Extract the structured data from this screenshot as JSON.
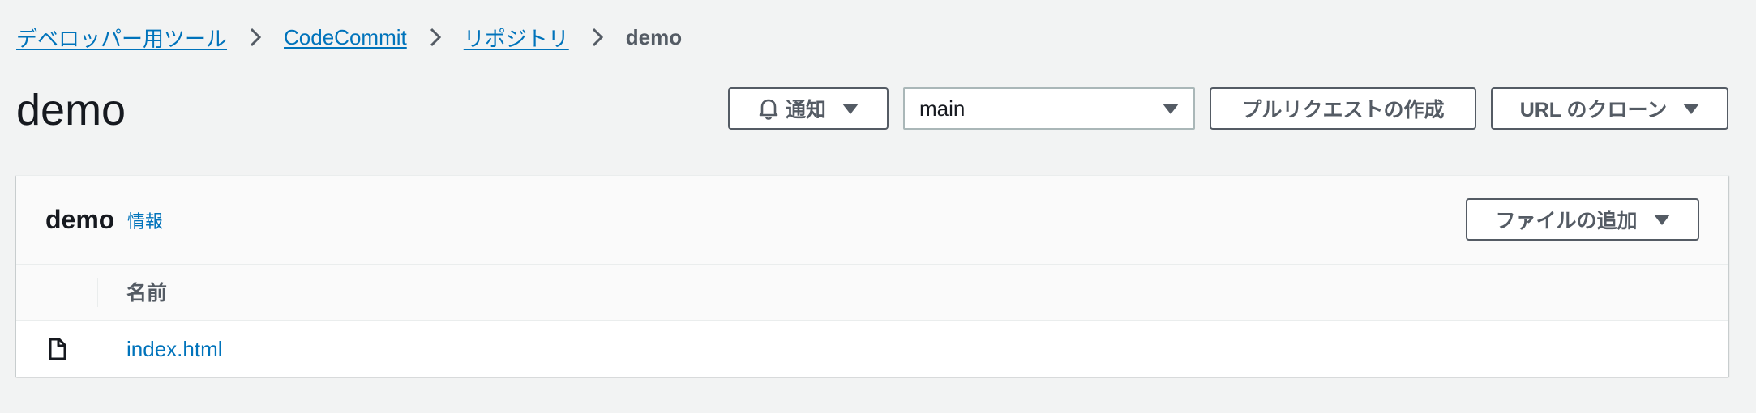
{
  "breadcrumb": {
    "items": [
      {
        "label": "デベロッパー用ツール"
      },
      {
        "label": "CodeCommit"
      },
      {
        "label": "リポジトリ"
      },
      {
        "label": "demo"
      }
    ]
  },
  "header": {
    "title": "demo",
    "notify_label": "通知",
    "branch_value": "main",
    "pull_request_label": "プルリクエストの作成",
    "clone_url_label": "URL のクローン"
  },
  "panel": {
    "title": "demo",
    "info_label": "情報",
    "add_file_label": "ファイルの追加",
    "table": {
      "columns": [
        "名前"
      ],
      "rows": [
        {
          "type": "file-icon",
          "name": "index.html"
        }
      ]
    }
  },
  "colors": {
    "background": "#f2f3f3",
    "link": "#0073bb",
    "text": "#16191f",
    "secondary_text": "#545b64"
  }
}
